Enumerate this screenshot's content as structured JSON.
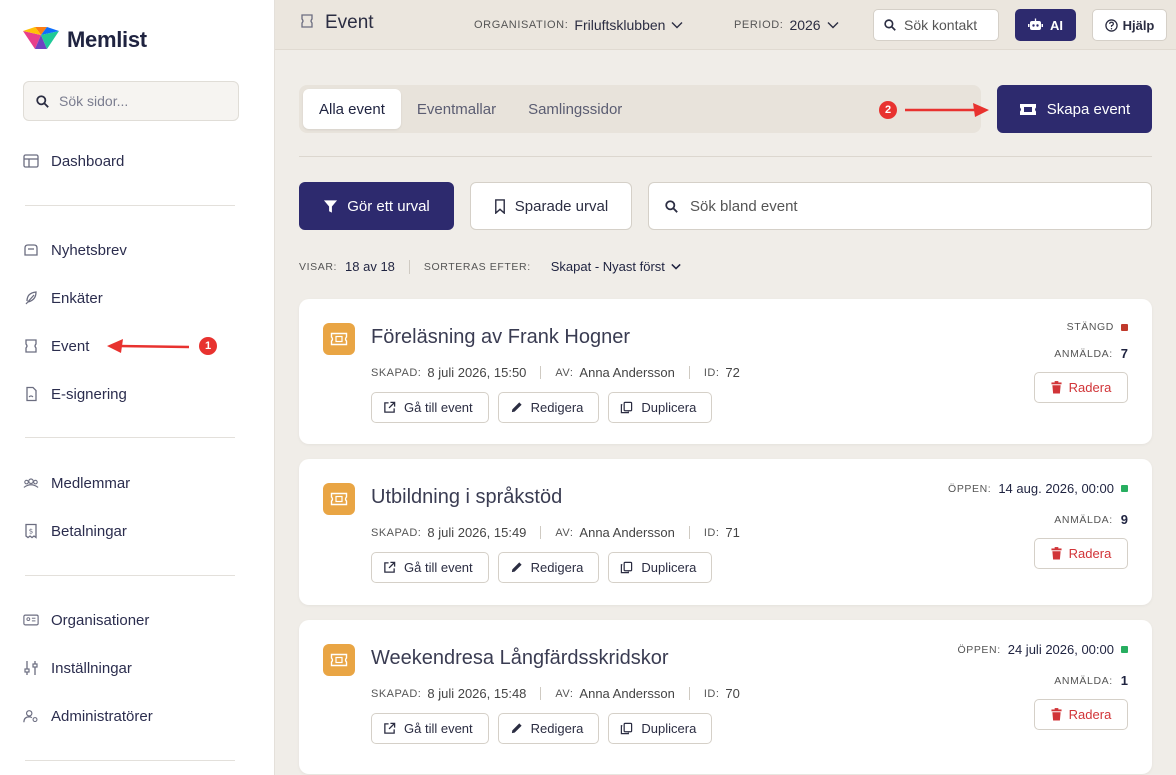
{
  "app": {
    "name": "Memlist"
  },
  "sidebar": {
    "search_placeholder": "Sök sidor...",
    "items": [
      {
        "label": "Dashboard",
        "icon": "table-icon"
      },
      {
        "label": "Nyhetsbrev",
        "icon": "mailbox-icon"
      },
      {
        "label": "Enkäter",
        "icon": "feather-icon"
      },
      {
        "label": "Event",
        "icon": "ticket-icon"
      },
      {
        "label": "E-signering",
        "icon": "document-icon"
      },
      {
        "label": "Medlemmar",
        "icon": "group-icon"
      },
      {
        "label": "Betalningar",
        "icon": "receipt-icon"
      },
      {
        "label": "Organisationer",
        "icon": "id-card-icon"
      },
      {
        "label": "Inställningar",
        "icon": "sliders-icon"
      },
      {
        "label": "Administratörer",
        "icon": "user-gear-icon"
      }
    ]
  },
  "topbar": {
    "title": "Event",
    "org_label": "ORGANISATION:",
    "org_value": "Friluftsklubben",
    "period_label": "PERIOD:",
    "period_value": "2026",
    "search_placeholder": "Sök kontakt",
    "ai_label": "AI",
    "help_label": "Hjälp"
  },
  "tabs": [
    {
      "label": "Alla event",
      "active": true
    },
    {
      "label": "Eventmallar",
      "active": false
    },
    {
      "label": "Samlingssidor",
      "active": false
    }
  ],
  "create_button": "Skapa event",
  "filter_button": "Gör ett urval",
  "saved_button": "Sparade urval",
  "event_search_placeholder": "Sök bland event",
  "list_info": {
    "showing_label": "VISAR:",
    "showing_value": "18 av 18",
    "sort_label": "SORTERAS EFTER:",
    "sort_value": "Skapat - Nyast först"
  },
  "meta_labels": {
    "created": "SKAPAD:",
    "by": "AV:",
    "id": "ID:",
    "registered": "ANMÄLDA:"
  },
  "action_labels": {
    "goto": "Gå till event",
    "edit": "Redigera",
    "duplicate": "Duplicera",
    "delete": "Radera"
  },
  "events": [
    {
      "title": "Föreläsning av Frank Hogner",
      "created": "8 juli 2026, 15:50",
      "author": "Anna Andersson",
      "id": "72",
      "status_label": "STÄNGD",
      "status_value": "",
      "status_color": "#c0392b",
      "registered": "7"
    },
    {
      "title": "Utbildning i språkstöd",
      "created": "8 juli 2026, 15:49",
      "author": "Anna Andersson",
      "id": "71",
      "status_label": "ÖPPEN:",
      "status_value": "14 aug. 2026, 00:00",
      "status_color": "#27ae60",
      "registered": "9"
    },
    {
      "title": "Weekendresa Långfärdsskridskor",
      "created": "8 juli 2026, 15:48",
      "author": "Anna Andersson",
      "id": "70",
      "status_label": "ÖPPEN:",
      "status_value": "24 juli 2026, 00:00",
      "status_color": "#27ae60",
      "registered": "1"
    }
  ],
  "annotations": [
    "1",
    "2"
  ],
  "colors": {
    "primary": "#2d2a6e",
    "event_icon": "#e9a544",
    "danger": "#d13438",
    "annotation": "#e8322f"
  }
}
